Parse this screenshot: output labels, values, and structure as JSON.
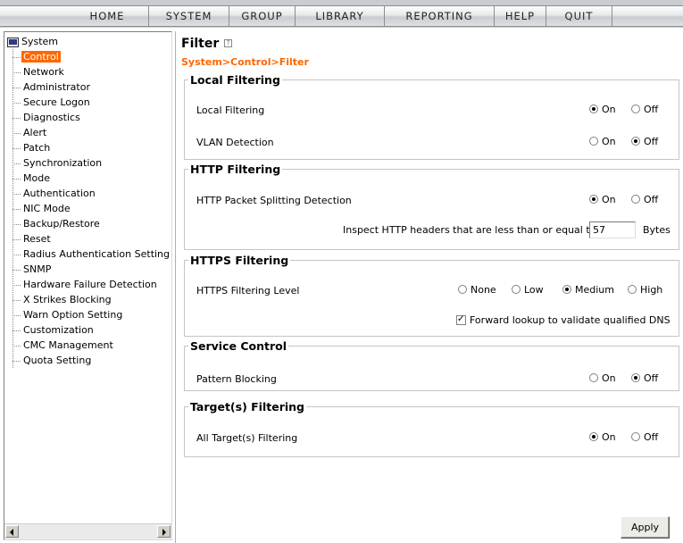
{
  "nav": {
    "items": [
      "HOME",
      "SYSTEM",
      "GROUP",
      "LIBRARY",
      "REPORTING",
      "HELP",
      "QUIT"
    ]
  },
  "sidebar": {
    "root_label": "System",
    "items": [
      {
        "label": "Control",
        "selected": true
      },
      {
        "label": "Network"
      },
      {
        "label": "Administrator"
      },
      {
        "label": "Secure Logon"
      },
      {
        "label": "Diagnostics"
      },
      {
        "label": "Alert"
      },
      {
        "label": "Patch"
      },
      {
        "label": "Synchronization"
      },
      {
        "label": "Mode"
      },
      {
        "label": "Authentication"
      },
      {
        "label": "NIC Mode"
      },
      {
        "label": "Backup/Restore"
      },
      {
        "label": "Reset"
      },
      {
        "label": "Radius Authentication Setting"
      },
      {
        "label": "SNMP"
      },
      {
        "label": "Hardware Failure Detection"
      },
      {
        "label": "X Strikes Blocking"
      },
      {
        "label": "Warn Option Setting"
      },
      {
        "label": "Customization"
      },
      {
        "label": "CMC Management"
      },
      {
        "label": "Quota Setting"
      }
    ]
  },
  "main": {
    "title": "Filter",
    "breadcrumb": "System>Control>Filter",
    "local": {
      "legend": "Local Filtering",
      "local_filtering_label": "Local Filtering",
      "vlan_label": "VLAN Detection",
      "on": "On",
      "off": "Off"
    },
    "http": {
      "legend": "HTTP Filtering",
      "splitting_label": "HTTP Packet Splitting Detection",
      "inspect_label": "Inspect HTTP headers that are less than or equal to",
      "bytes_value": "57",
      "bytes_unit": "Bytes",
      "on": "On",
      "off": "Off"
    },
    "https": {
      "legend": "HTTPS Filtering",
      "level_label": "HTTPS Filtering Level",
      "none": "None",
      "low": "Low",
      "medium": "Medium",
      "high": "High",
      "forward_lookup_label": "Forward lookup to validate qualified DNS",
      "forward_lookup_checked": true
    },
    "service": {
      "legend": "Service Control",
      "pattern_label": "Pattern Blocking",
      "on": "On",
      "off": "Off"
    },
    "target": {
      "legend": "Target(s) Filtering",
      "all_label": "All Target(s) Filtering",
      "on": "On",
      "off": "Off"
    },
    "apply_label": "Apply"
  }
}
